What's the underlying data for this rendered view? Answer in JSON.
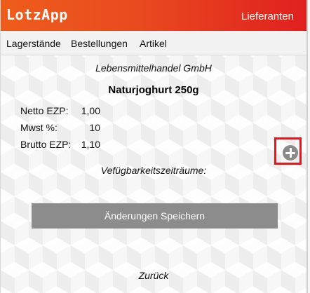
{
  "header": {
    "logo": "LotzApp",
    "link": "Lieferanten"
  },
  "nav": {
    "items": [
      "Lagerstände",
      "Bestellungen",
      "Artikel"
    ]
  },
  "main": {
    "supplier": "Lebensmittelhandel GmbH",
    "product": "Naturjoghurt 250g",
    "details": [
      {
        "label": "Netto EZP:",
        "value": "1,00"
      },
      {
        "label": "Mwst %:",
        "value": "10"
      },
      {
        "label": "Brutto EZP:",
        "value": "1,10"
      }
    ],
    "availability_heading": "Vefügbarkeitszeiträume:",
    "save_label": "Änderungen Speichern",
    "back_label": "Zurück"
  },
  "icons": {
    "add": "plus-circle-icon"
  },
  "colors": {
    "header_start": "#ee5d1c",
    "header_end": "#e0201f",
    "button": "#8c8c8c",
    "highlight": "#e0191f"
  }
}
